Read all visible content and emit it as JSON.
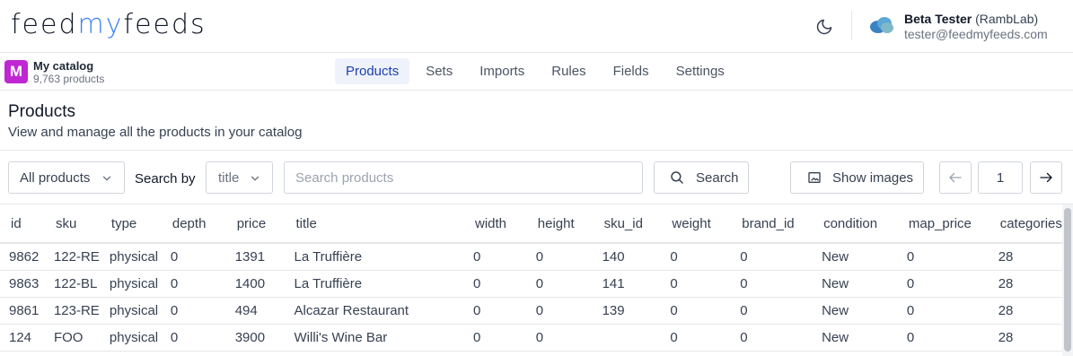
{
  "header": {
    "logo_part1": "feed",
    "logo_part2": "my",
    "logo_part3": "feeds",
    "user_name": "Beta Tester",
    "user_org": "(RambLab)",
    "user_email": "tester@feedmyfeeds.com"
  },
  "catalog": {
    "avatar_letter": "M",
    "name": "My catalog",
    "count": "9,763 products"
  },
  "tabs": [
    {
      "label": "Products"
    },
    {
      "label": "Sets"
    },
    {
      "label": "Imports"
    },
    {
      "label": "Rules"
    },
    {
      "label": "Fields"
    },
    {
      "label": "Settings"
    }
  ],
  "page": {
    "title": "Products",
    "subtitle": "View and manage all the products in your catalog"
  },
  "toolbar": {
    "filter_value": "All products",
    "search_by_label": "Search by",
    "search_field_value": "title",
    "search_placeholder": "Search products",
    "search_button": "Search",
    "images_button": "Show images",
    "page_number": "1"
  },
  "table": {
    "columns": [
      "id",
      "sku",
      "type",
      "depth",
      "price",
      "title",
      "width",
      "height",
      "sku_id",
      "weight",
      "brand_id",
      "condition",
      "map_price",
      "categories"
    ],
    "rows": [
      [
        "9862",
        "122-RE",
        "physical",
        "0",
        "1391",
        "La Truffière",
        "0",
        "0",
        "140",
        "0",
        "0",
        "New",
        "0",
        "28"
      ],
      [
        "9863",
        "122-BL",
        "physical",
        "0",
        "1400",
        "La Truffière",
        "0",
        "0",
        "141",
        "0",
        "0",
        "New",
        "0",
        "28"
      ],
      [
        "9861",
        "123-RE",
        "physical",
        "0",
        "494",
        "Alcazar Restaurant",
        "0",
        "0",
        "139",
        "0",
        "0",
        "New",
        "0",
        "28"
      ],
      [
        "124",
        "FOO",
        "physical",
        "0",
        "3900",
        "Willi's Wine Bar",
        "0",
        "0",
        "",
        "0",
        "0",
        "New",
        "0",
        "28"
      ]
    ]
  },
  "colors": {
    "accent": "#3b82f6",
    "active_tab_bg": "#eef2fb",
    "active_tab_text": "#1e40af",
    "catalog_avatar": "#c026d3"
  }
}
